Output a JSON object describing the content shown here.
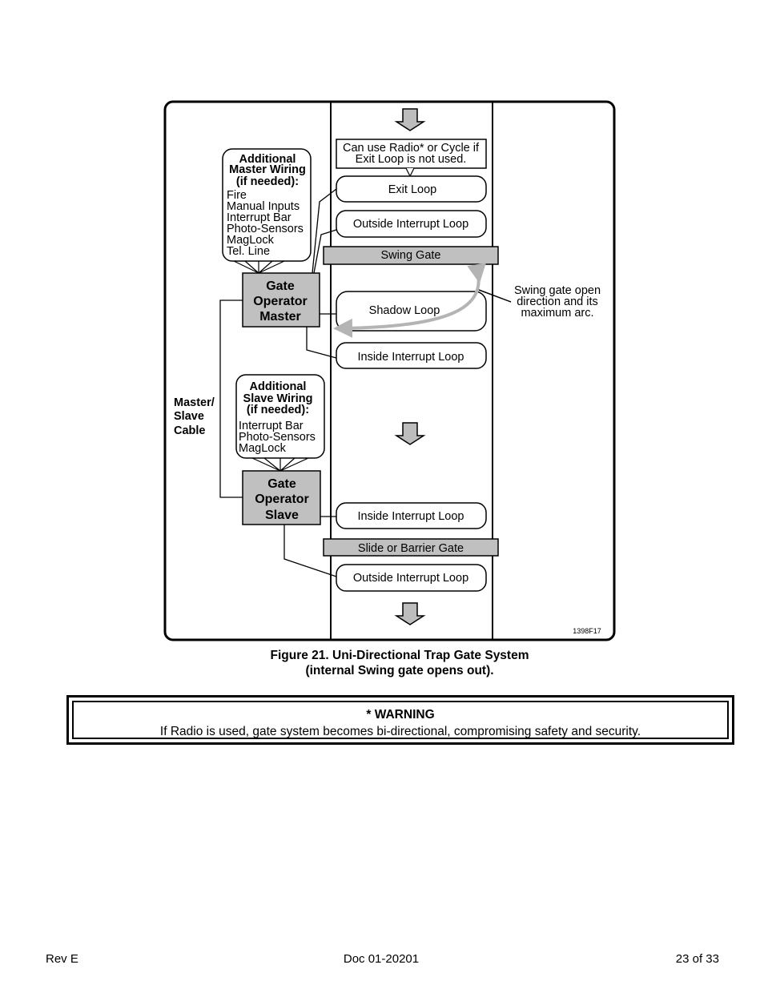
{
  "diagram": {
    "radio_note": [
      "Can use Radio* or Cycle if",
      "Exit Loop is not used."
    ],
    "exit_loop": "Exit Loop",
    "outside_interrupt_loop_top": "Outside Interrupt  Loop",
    "swing_gate": "Swing Gate",
    "shadow_loop": "Shadow Loop",
    "inside_interrupt_loop_top": "Inside Interrupt  Loop",
    "inside_interrupt_loop_bottom": "Inside Interrupt  Loop",
    "slide_gate": "Slide or Barrier Gate",
    "outside_interrupt_loop_bottom": "Outside Interrupt  Loop",
    "master_wiring": {
      "title": [
        "Additional",
        "Master Wiring",
        "(if needed):"
      ],
      "items": [
        "Fire",
        "Manual Inputs",
        "Interrupt  Bar",
        "Photo-Sensors",
        "MagLock",
        "Tel. Line"
      ]
    },
    "master_operator": [
      "Gate",
      "Operator",
      "Master"
    ],
    "slave_wiring": {
      "title": [
        "Additional",
        "Slave Wiring",
        "(if needed):"
      ],
      "items": [
        "Interrupt  Bar",
        "Photo-Sensors",
        "MagLock"
      ]
    },
    "slave_operator": [
      "Gate",
      "Operator",
      "Slave"
    ],
    "cable_label": [
      "Master/",
      "Slave",
      "Cable"
    ],
    "swing_note": [
      "Swing gate open",
      "direction and its",
      "maximum arc."
    ],
    "figure_code": "1398F17"
  },
  "caption": [
    "Figure 21.  Uni-Directional Trap Gate System",
    "(internal Swing gate opens out)."
  ],
  "warning": {
    "title": "* WARNING",
    "text": "If Radio is used, gate system becomes bi-directional, compromising safety and security."
  },
  "footer": {
    "left": "Rev E",
    "center": "Doc 01-20201",
    "right": "23 of 33"
  },
  "colors": {
    "gray_fill": "#c0c0c0",
    "arc": "#b4b4b4"
  }
}
